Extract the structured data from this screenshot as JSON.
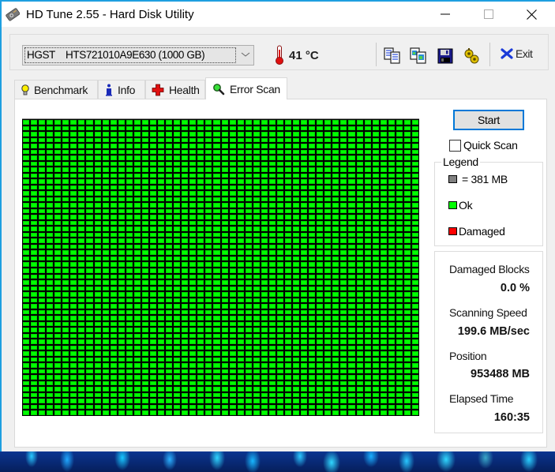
{
  "window": {
    "title": "HD Tune 2.55 - Hard Disk Utility",
    "controls": {
      "minimize": "minimize",
      "maximize": "maximize",
      "close": "close"
    }
  },
  "toolbar": {
    "drive_selected": "HGST    HTS721010A9E630 (1000 GB)",
    "temperature": "41 °C",
    "buttons": [
      {
        "name": "copy-text-button",
        "icon": "copy-text-icon"
      },
      {
        "name": "copy-screenshot-button",
        "icon": "copy-screenshot-icon"
      },
      {
        "name": "save-button",
        "icon": "floppy-disk-icon"
      },
      {
        "name": "options-button",
        "icon": "gears-icon"
      }
    ],
    "exit_label": "Exit"
  },
  "tabs": [
    {
      "label": "Benchmark",
      "icon": "lightbulb-icon",
      "active": false
    },
    {
      "label": "Info",
      "icon": "info-icon",
      "active": false
    },
    {
      "label": "Health",
      "icon": "red-cross-icon",
      "active": false
    },
    {
      "label": "Error Scan",
      "icon": "magnifier-icon",
      "active": true
    }
  ],
  "error_scan": {
    "grid": {
      "columns": 50,
      "rows": 50,
      "status": "ok"
    },
    "start_label": "Start",
    "quick_scan_label": "Quick Scan",
    "quick_scan_checked": false,
    "legend": {
      "title": "Legend",
      "items": [
        {
          "label": "= 381 MB",
          "color": "#808080"
        },
        {
          "label": "Ok",
          "color": "#00ff00"
        },
        {
          "label": "Damaged",
          "color": "#ff0000"
        }
      ]
    },
    "stats": {
      "damaged_blocks_label": "Damaged Blocks",
      "damaged_blocks_value": "0.0 %",
      "scanning_speed_label": "Scanning Speed",
      "scanning_speed_value": "199.6 MB/sec",
      "position_label": "Position",
      "position_value": "953488 MB",
      "elapsed_time_label": "Elapsed Time",
      "elapsed_time_value": "160:35"
    }
  }
}
